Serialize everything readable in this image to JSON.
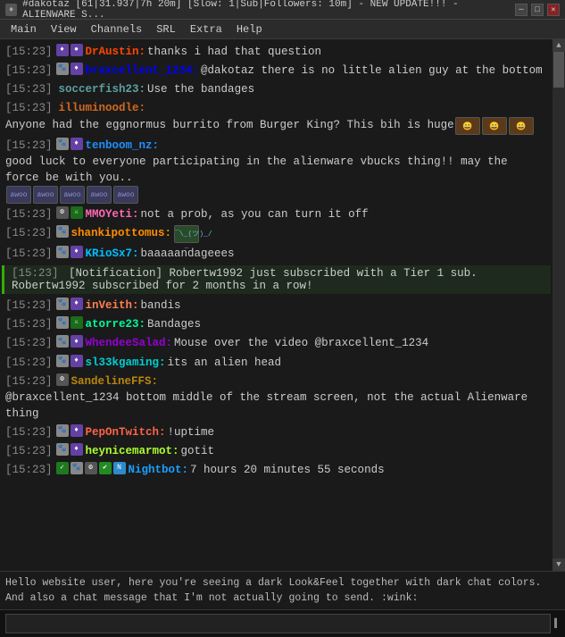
{
  "titlebar": {
    "title": "#dakotaz [61|31.937|7h 20m] [Slow: 1|Sub|Followers: 10m] - NEW UPDATE!!! - ALIENWARE S...",
    "icon": "♦"
  },
  "menubar": {
    "items": [
      "Main",
      "View",
      "Channels",
      "SRL",
      "Extra",
      "Help"
    ]
  },
  "chat": {
    "lines": [
      {
        "id": 1,
        "timestamp": "[15:23]",
        "badges": [
          {
            "type": "sub",
            "symbol": "♦"
          },
          {
            "type": "prime",
            "symbol": "●"
          }
        ],
        "username": "DrAustin:",
        "username_color": "color-draustin",
        "message": " thanks i had that question",
        "emotes": []
      },
      {
        "id": 2,
        "timestamp": "[15:23]",
        "badges": [
          {
            "type": "paw",
            "symbol": "🐾"
          },
          {
            "type": "sub",
            "symbol": "♦"
          }
        ],
        "username": "braxcellent_1234:",
        "username_color": "color-brax",
        "message": " @dakotaz there is no little alien guy at the bottom",
        "emotes": []
      },
      {
        "id": 3,
        "timestamp": "[15:23]",
        "badges": [],
        "username": "soccerfish23:",
        "username_color": "color-soccer",
        "message": " Use the bandages",
        "emotes": []
      },
      {
        "id": 4,
        "timestamp": "[15:23]",
        "badges": [],
        "username": "illuminoodle:",
        "username_color": "color-illumin",
        "message": " Anyone had the eggnormus burrito from Burger King? This bih is huge",
        "emotes": [
          "face1",
          "face2",
          "face3"
        ]
      },
      {
        "id": 5,
        "timestamp": "[15:23]",
        "badges": [
          {
            "type": "paw",
            "symbol": "🐾"
          },
          {
            "type": "sub",
            "symbol": "♦"
          }
        ],
        "username": "tenboom_nz:",
        "username_color": "color-tenboom",
        "message": " good luck to everyone participating in the alienware vbucks thing!! may the force be with you.. ",
        "emotes": [
          "awoo",
          "awoo",
          "awoo",
          "awoo",
          "awoo"
        ]
      },
      {
        "id": 6,
        "timestamp": "[15:23]",
        "badges": [
          {
            "type": "gear",
            "symbol": "⚙"
          },
          {
            "type": "mod",
            "symbol": "⚔"
          }
        ],
        "username": "MMOYeti:",
        "username_color": "color-mmoyeti",
        "message": " not a prob, as you can turn it off",
        "emotes": []
      },
      {
        "id": 7,
        "timestamp": "[15:23]",
        "badges": [
          {
            "type": "paw",
            "symbol": "🐾"
          }
        ],
        "username": "shankipottomus:",
        "username_color": "color-shanki",
        "message": " ",
        "emotes": [
          "emote1"
        ]
      },
      {
        "id": 8,
        "timestamp": "[15:23]",
        "badges": [
          {
            "type": "paw",
            "symbol": "🐾"
          },
          {
            "type": "sub",
            "symbol": "♦"
          }
        ],
        "username": "KRioSx7:",
        "username_color": "color-krios",
        "message": " baaaaandageees",
        "emotes": []
      },
      {
        "id": 9,
        "type": "notification",
        "timestamp": "[15:23]",
        "message": "[Notification] Robertw1992 just subscribed with a Tier 1 sub. Robertw1992 subscribed for 2 months in a row!"
      },
      {
        "id": 10,
        "timestamp": "[15:23]",
        "badges": [
          {
            "type": "paw",
            "symbol": "🐾"
          },
          {
            "type": "sub",
            "symbol": "♦"
          }
        ],
        "username": "inVeith:",
        "username_color": "color-inveith",
        "message": " bandis",
        "emotes": []
      },
      {
        "id": 11,
        "timestamp": "[15:23]",
        "badges": [
          {
            "type": "paw",
            "symbol": "🐾"
          },
          {
            "type": "mod",
            "symbol": "⚔"
          }
        ],
        "username": "atorre23:",
        "username_color": "color-atorre",
        "message": " Bandages",
        "emotes": []
      },
      {
        "id": 12,
        "timestamp": "[15:23]",
        "badges": [
          {
            "type": "paw",
            "symbol": "🐾"
          },
          {
            "type": "sub",
            "symbol": "♦"
          }
        ],
        "username": "WhendeeSalad:",
        "username_color": "color-whende",
        "message": " Mouse over the video @braxcellent_1234",
        "emotes": []
      },
      {
        "id": 13,
        "timestamp": "[15:23]",
        "badges": [
          {
            "type": "paw",
            "symbol": "🐾"
          },
          {
            "type": "sub",
            "symbol": "♦"
          }
        ],
        "username": "sl33kgaming:",
        "username_color": "color-s133k",
        "message": " its an alien head",
        "emotes": []
      },
      {
        "id": 14,
        "timestamp": "[15:23]",
        "badges": [
          {
            "type": "gear",
            "symbol": "⚙"
          }
        ],
        "username": "SandelineFFS:",
        "username_color": "color-sandeline",
        "message": " @braxcellent_1234 bottom middle of the stream screen, not the actual Alienware thing",
        "emotes": []
      },
      {
        "id": 15,
        "timestamp": "[15:23]",
        "badges": [
          {
            "type": "paw",
            "symbol": "🐾"
          },
          {
            "type": "sub",
            "symbol": "♦"
          }
        ],
        "username": "PepOnTwitch:",
        "username_color": "color-peptwitch",
        "message": " !uptime",
        "emotes": []
      },
      {
        "id": 16,
        "timestamp": "[15:23]",
        "badges": [
          {
            "type": "paw",
            "symbol": "🐾"
          },
          {
            "type": "sub",
            "symbol": "♦"
          }
        ],
        "username": "heynicemarmot:",
        "username_color": "color-heynice",
        "message": " gotit",
        "emotes": []
      },
      {
        "id": 17,
        "timestamp": "[15:23]",
        "badges": [
          {
            "type": "check",
            "symbol": "✓"
          },
          {
            "type": "paw",
            "symbol": "🐾"
          },
          {
            "type": "gear",
            "symbol": "⚙"
          },
          {
            "type": "check2",
            "symbol": "✔"
          },
          {
            "type": "bot",
            "symbol": "N"
          }
        ],
        "username": "Nightbot:",
        "username_color": "color-nightbot",
        "message": " 7 hours 20 minutes 55 seconds",
        "emotes": []
      }
    ]
  },
  "infobar": {
    "text": "Hello website user, here you're seeing a dark Look&Feel together with dark chat colors. And also a chat message that I'm not actually going to send. :wink:"
  },
  "input": {
    "value": "",
    "placeholder": ""
  },
  "scrollbar": {
    "up_arrow": "▲",
    "down_arrow": "▼"
  }
}
